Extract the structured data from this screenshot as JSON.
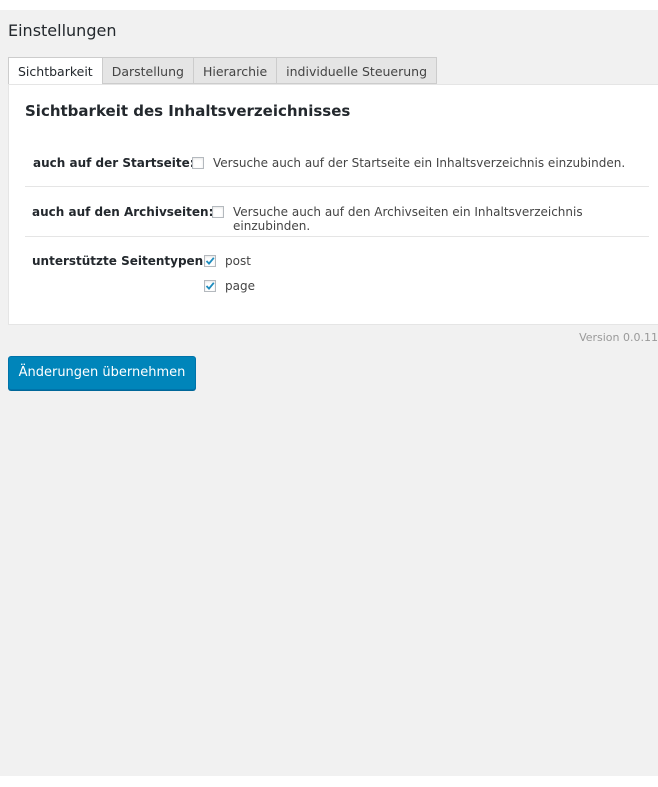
{
  "page": {
    "title": "Einstellungen"
  },
  "tabs": [
    {
      "label": "Sichtbarkeit",
      "active": true
    },
    {
      "label": "Darstellung",
      "active": false
    },
    {
      "label": "Hierarchie",
      "active": false
    },
    {
      "label": "individuelle Steuerung",
      "active": false
    }
  ],
  "section": {
    "title": "Sichtbarkeit des Inhaltsverzeichnisses",
    "rows": [
      {
        "label": "auch auf der Startseite:",
        "checkbox_checked": false,
        "description": "Versuche auch auf der Startseite ein Inhaltsverzeichnis einzubinden."
      },
      {
        "label": "auch auf den Archivseiten:",
        "checkbox_checked": false,
        "description": "Versuche auch auf den Archivseiten ein Inhaltsverzeichnis einzubinden."
      },
      {
        "label": "unterstützte Seitentypen:",
        "options": [
          {
            "label": "post",
            "checked": true
          },
          {
            "label": "page",
            "checked": true
          }
        ]
      }
    ]
  },
  "footer": {
    "version": "Version 0.0.11"
  },
  "actions": {
    "submit_label": "Änderungen übernehmen"
  },
  "colors": {
    "accent": "#0085ba",
    "background": "#f1f1f1",
    "checkmark": "#1e8cbe"
  }
}
